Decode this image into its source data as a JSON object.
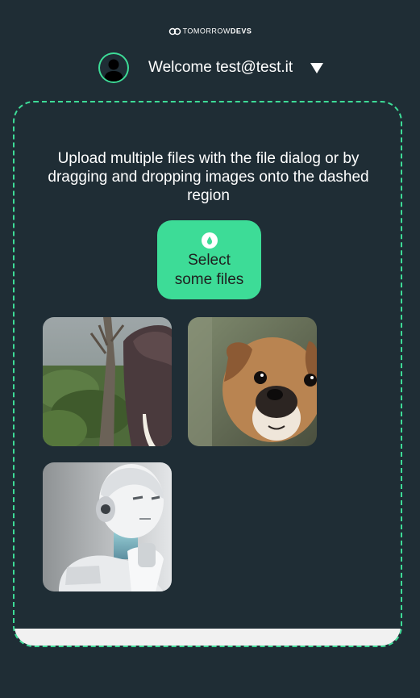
{
  "brand": {
    "name_light": "TOMORROW",
    "name_bold": "DEVS",
    "logo_icon": "tomorrowdevs-logo-icon"
  },
  "header": {
    "welcome_label": "Welcome",
    "user_email": "test@test.it",
    "avatar_icon": "user-avatar-icon",
    "menu_icon": "dropdown-triangle-icon"
  },
  "dropzone": {
    "instructions": "Upload multiple files with the file dialog or by dragging and dropping images onto the dashed region",
    "select_button": {
      "line1": "Select",
      "line2": "some files",
      "icon": "upload-drop-icon"
    }
  },
  "gallery": [
    {
      "subject": "elephant"
    },
    {
      "subject": "puppy"
    },
    {
      "subject": "robot"
    }
  ],
  "colors": {
    "background": "#1f2d35",
    "accent": "#3ddc97",
    "text": "#ffffff",
    "footer": "#f1f1f1"
  }
}
